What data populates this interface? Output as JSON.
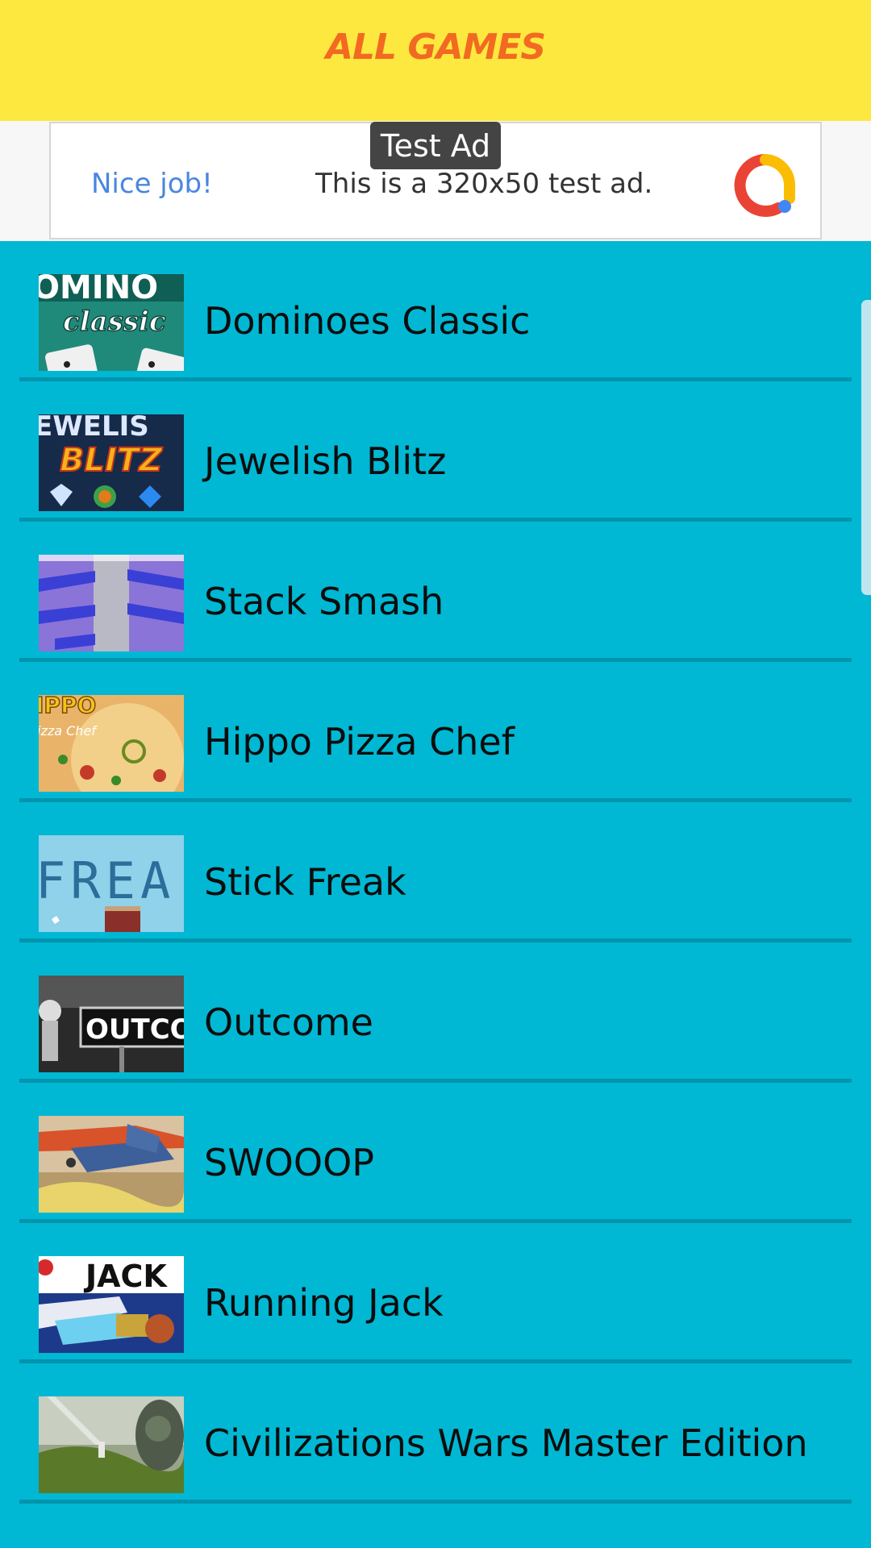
{
  "header": {
    "title": "ALL GAMES"
  },
  "ad": {
    "badge": "Test Ad",
    "nice": "Nice job!",
    "text": "This is a 320x50 test ad.",
    "logo_icon": "admob-logo-icon"
  },
  "games": [
    {
      "name": "Dominoes Classic",
      "thumb_icon": "dominoes-classic-thumbnail",
      "thumb_label": "classic"
    },
    {
      "name": "Jewelish Blitz",
      "thumb_icon": "jewelish-blitz-thumbnail",
      "thumb_label": "BLITZ"
    },
    {
      "name": "Stack Smash",
      "thumb_icon": "stack-smash-thumbnail"
    },
    {
      "name": "Hippo Pizza Chef",
      "thumb_icon": "hippo-pizza-chef-thumbnail"
    },
    {
      "name": "Stick Freak",
      "thumb_icon": "stick-freak-thumbnail",
      "thumb_label": "FREA"
    },
    {
      "name": "Outcome",
      "thumb_icon": "outcome-thumbnail",
      "thumb_label": "OUTCO"
    },
    {
      "name": "SWOOOP",
      "thumb_icon": "swooop-thumbnail"
    },
    {
      "name": "Running Jack",
      "thumb_icon": "running-jack-thumbnail",
      "thumb_label": "JACK"
    },
    {
      "name": "Civilizations Wars Master Edition",
      "thumb_icon": "civilizations-wars-thumbnail"
    }
  ],
  "colors": {
    "header_bg": "#fde83f",
    "header_text": "#f26a21",
    "list_bg": "#00b8d4",
    "divider": "#0094ad"
  }
}
